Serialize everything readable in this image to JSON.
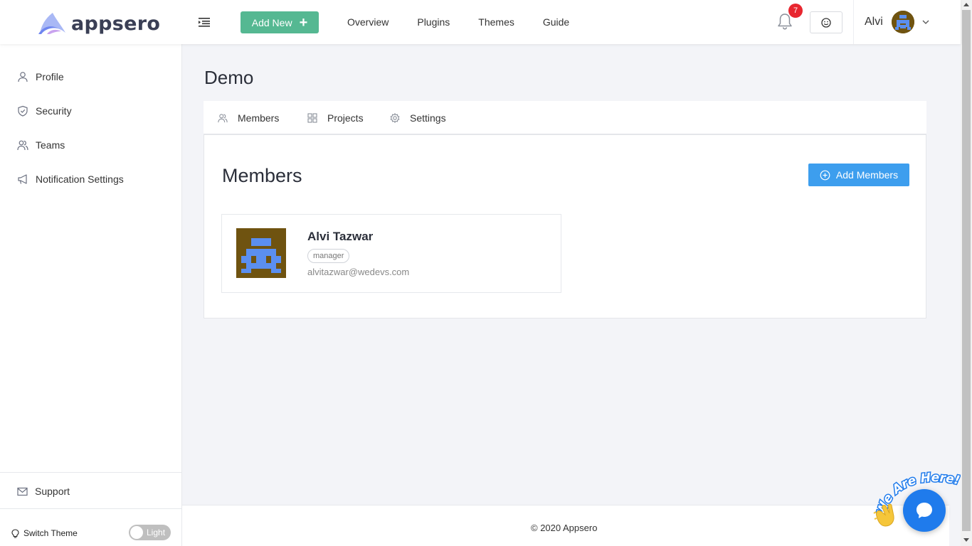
{
  "brand": {
    "name": "appsero"
  },
  "header": {
    "add_new_label": "Add New",
    "nav": [
      "Overview",
      "Plugins",
      "Themes",
      "Guide"
    ],
    "notification_count": "7",
    "user_name": "Alvi"
  },
  "sidebar": {
    "items": [
      {
        "label": "Profile",
        "icon": "user-icon"
      },
      {
        "label": "Security",
        "icon": "shield-icon"
      },
      {
        "label": "Teams",
        "icon": "team-icon"
      },
      {
        "label": "Notification Settings",
        "icon": "megaphone-icon"
      }
    ],
    "support_label": "Support",
    "switch_theme_label": "Switch Theme",
    "theme_toggle_label": "Light"
  },
  "main": {
    "page_title": "Demo",
    "tabs": [
      {
        "label": "Members",
        "icon": "team-icon"
      },
      {
        "label": "Projects",
        "icon": "grid-icon"
      },
      {
        "label": "Settings",
        "icon": "gear-icon"
      }
    ],
    "panel_title": "Members",
    "add_members_label": "Add Members",
    "members": [
      {
        "name": "Alvi Tazwar",
        "role": "manager",
        "email": "alvitazwar@wedevs.com"
      }
    ]
  },
  "footer": {
    "copyright": "© 2020 Appsero"
  },
  "chat": {
    "badge_text": "We Are Here!"
  },
  "colors": {
    "add_new_bg": "#55b892",
    "add_members_bg": "#3d9eee",
    "notification_badge": "#e8262f",
    "avatar_bg": "#6f5310",
    "avatar_fg": "#5b8ff0",
    "chat_bg": "#1f7bec"
  }
}
